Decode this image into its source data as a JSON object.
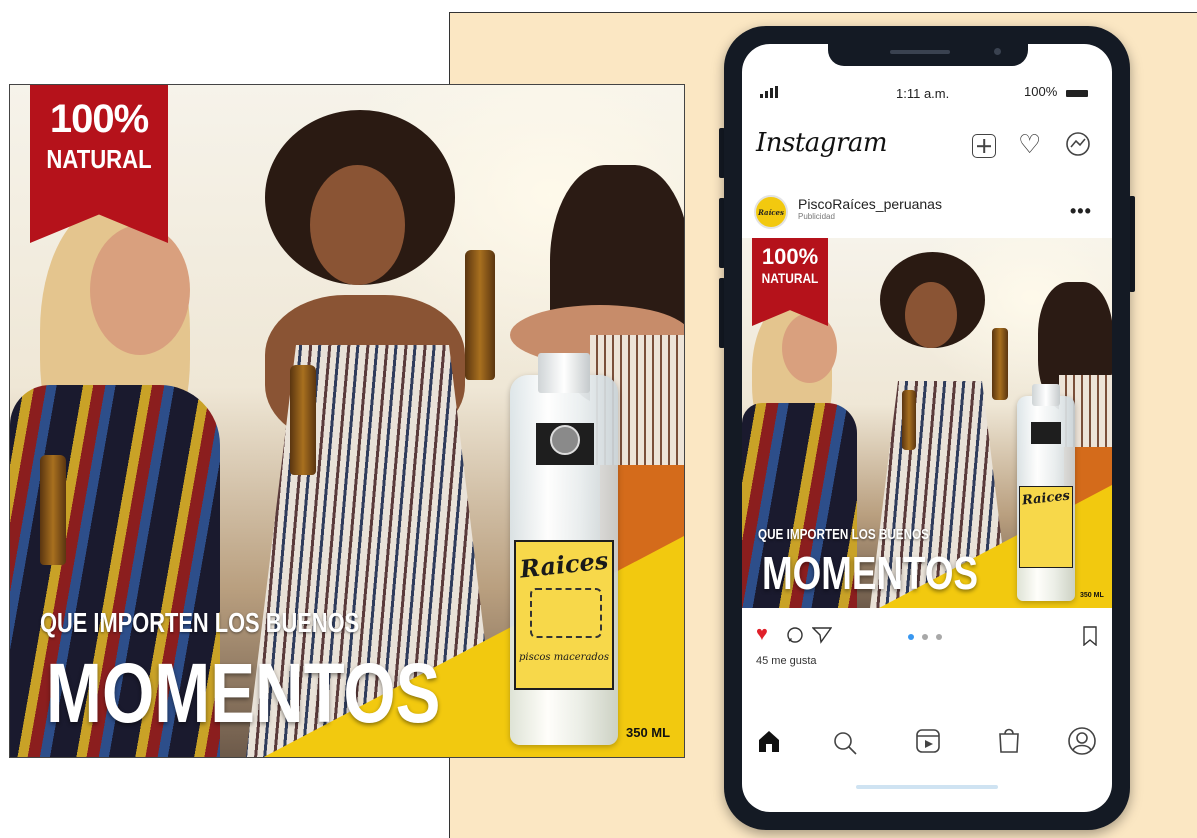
{
  "ad": {
    "badge_line1": "100%",
    "badge_line2": "NATURAL",
    "slogan_small": "QUE IMPORTEN  LOS BUENOS",
    "slogan_big": "MOMENTOS",
    "bottle_brand": "Raices",
    "bottle_sub": "piscos macerados",
    "bottle_volume": "350 ML"
  },
  "phone": {
    "status_time": "1:11 a.m.",
    "status_battery": "100%",
    "app_name": "Instagram",
    "header_icons": [
      "new-post-icon",
      "heart-icon",
      "messenger-icon"
    ],
    "post": {
      "username": "PiscoRaíces_peruanas",
      "sponsored": "Publicidad",
      "avatar_text": "Raíces",
      "likes": "45 me gusta",
      "carousel_pages": 3,
      "carousel_active": 1
    },
    "bottom_nav": [
      "home-icon",
      "search-icon",
      "reels-icon",
      "shop-icon",
      "profile-icon"
    ]
  },
  "colors": {
    "brand_red": "#b5121b",
    "brand_yellow": "#f2c90f",
    "panel_bg": "#fbe7c3",
    "like_red": "#e0202a",
    "carousel_active": "#3897f0"
  }
}
